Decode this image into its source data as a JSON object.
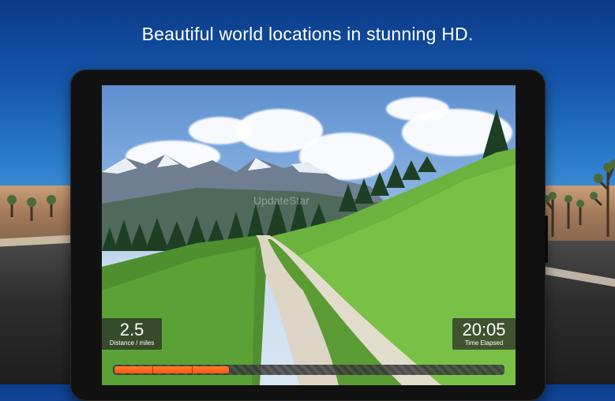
{
  "headline": "Beautiful world locations in stunning HD.",
  "ride": {
    "distance_value": "2.5",
    "distance_label": "Distance / miles",
    "time_value": "20:05",
    "time_label": "Time Elapsed"
  },
  "progress": {
    "fraction": 0.3
  },
  "watermark": "UpdateStar",
  "colors": {
    "accent": "#ff5a14",
    "overlay": "#282828"
  }
}
